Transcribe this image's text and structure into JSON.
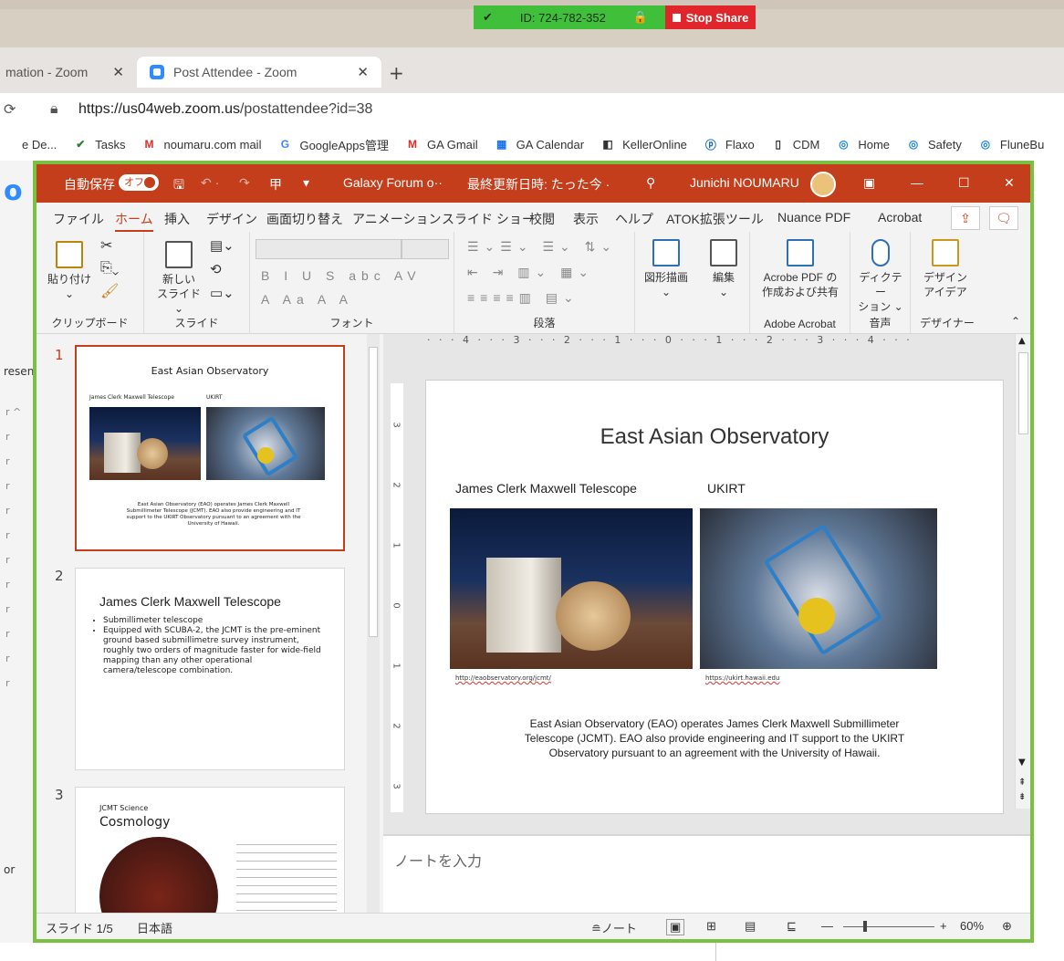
{
  "zoom_share_bar": {
    "meeting_id": "ID: 724-782-352",
    "stop_label": "Stop Share"
  },
  "browser": {
    "tabs": [
      {
        "label": "mation - Zoom"
      },
      {
        "label": "Post Attendee - Zoom"
      }
    ],
    "url_host": "https://us04web.zoom.us",
    "url_path": "/postattendee?id=38",
    "bookmarks": [
      {
        "label": "e De...",
        "icon": "bookmark-icon"
      },
      {
        "label": "Tasks",
        "icon": "tasks-check-icon",
        "color": "#2e7d32"
      },
      {
        "label": "noumaru.com mail",
        "icon": "gmail-icon",
        "color": "#d93025"
      },
      {
        "label": "GoogleApps管理",
        "icon": "google-icon",
        "color": "#4285f4"
      },
      {
        "label": "GA Gmail",
        "icon": "gmail-icon",
        "color": "#d93025"
      },
      {
        "label": "GA Calendar",
        "icon": "calendar-icon",
        "color": "#1a73e8"
      },
      {
        "label": "KellerOnline",
        "icon": "kellerwilliams-icon",
        "color": "#333333"
      },
      {
        "label": "Flaxo",
        "icon": "flaxo-icon",
        "color": "#1565c0"
      },
      {
        "label": "CDM",
        "icon": "page-icon",
        "color": "#333333"
      },
      {
        "label": "Home",
        "icon": "globe-icon",
        "color": "#1e88e5"
      },
      {
        "label": "Safety",
        "icon": "globe-icon",
        "color": "#1e88e5"
      },
      {
        "label": "FluneBu",
        "icon": "globe-icon",
        "color": "#1e88e5"
      }
    ],
    "left_fragment_1": "resent",
    "left_fragment_2": "or"
  },
  "ppt": {
    "autosave_label": "自動保存",
    "autosave_state": "オフ",
    "doc_title": "Galaxy Forum o··",
    "last_saved": "最終更新日時: たった今 ·",
    "user": "Junichi NOUMARU",
    "accent": "#c43e1c",
    "menu": [
      "ファイル",
      "ホーム",
      "挿入",
      "デザイン",
      "画面切り替え",
      "アニメーション",
      "スライド ショー",
      "校閲",
      "表示",
      "ヘルプ",
      "ATOK拡張ツール",
      "Nuance PDF",
      "Acrobat"
    ],
    "ribbon": {
      "paste": "貼り付け",
      "new_slide_1": "新しい",
      "new_slide_2": "スライド",
      "group_clipboard": "クリップボード",
      "group_slides": "スライド",
      "group_font": "フォント",
      "group_paragraph": "段落",
      "draw_shape": "図形描画",
      "edit": "編集",
      "acrobat_1": "Acrobe PDF の",
      "acrobat_2": "作成および共有",
      "group_acrobat": "Adobe Acrobat",
      "dictate_1": "ディクテー",
      "dictate_2": "ション",
      "group_voice": "音声",
      "designer_1": "デザイン",
      "designer_2": "アイデア",
      "group_designer": "デザイナー",
      "font_glyphs": "B I U S abc AV",
      "font_glyphs2": "A Aa A A"
    },
    "ruler_h": "· · · 4 · · · 3 · · · 2 · · · 1 · · · 0 · · · 1 · · · 2 · · · 3 · · · 4 · · ·",
    "thumbnails": [
      {
        "num": "1",
        "title": "East Asian Observatory",
        "left_caption": "James Clerk Maxwell Telescope",
        "right_caption": "UKIRT",
        "body": "East Asian Observatory (EAO) operates James Clerk Maxwell Submillimeter Telescope (JCMT). EAO also provide engineering and IT support to the UKIRT Observatory pursuant to an agreement with the University of Hawaii."
      },
      {
        "num": "2",
        "title": "James Clerk Maxwell Telescope",
        "bullets": [
          "Submillimeter telescope",
          "Equipped with SCUBA-2, the JCMT is the pre-eminent ground based submillimetre survey instrument, roughly two orders of magnitude faster for wide-field mapping than any other operational camera/telescope combination."
        ]
      },
      {
        "num": "3",
        "kicker": "JCMT Science",
        "title": "Cosmology"
      }
    ],
    "slide": {
      "title": "East Asian Observatory",
      "left_caption": "James Clerk Maxwell Telescope",
      "right_caption": "UKIRT",
      "left_link": "http://eaobservatory.org/jcmt/",
      "right_link": "https://ukirt.hawaii.edu",
      "body_1": "East Asian Observatory (EAO) operates James Clerk Maxwell Submillimeter",
      "body_2": "Telescope (JCMT). EAO also provide engineering and IT support to the UKIRT",
      "body_3": "Observatory pursuant to an agreement with the University of Hawaii."
    },
    "notes_placeholder": "ノートを入力",
    "status": {
      "slide_count": "スライド 1/5",
      "language": "日本語",
      "notes_btn": "ノート",
      "zoom_level": "60%",
      "zoom_fraction": 0.6
    }
  }
}
